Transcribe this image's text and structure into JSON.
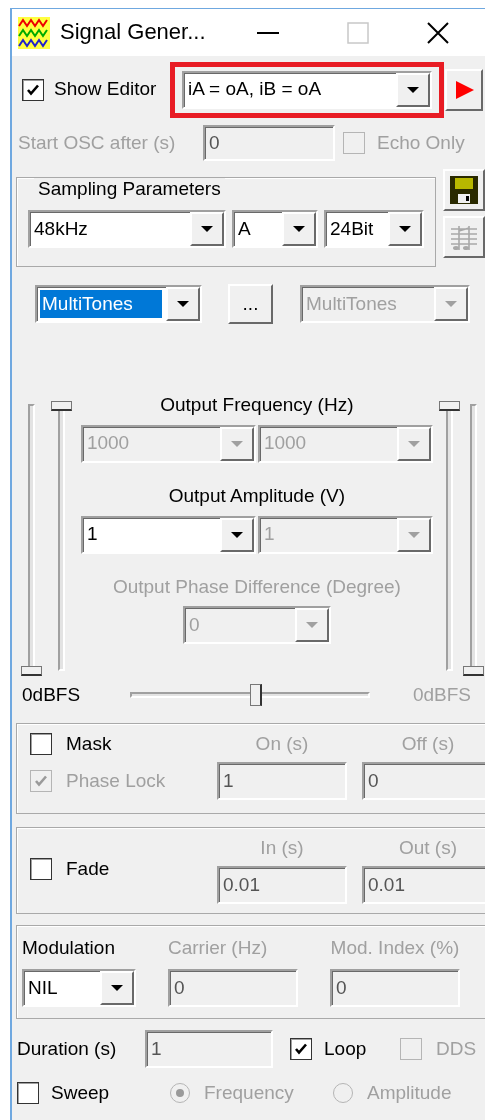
{
  "window": {
    "title": "Signal Gener..."
  },
  "editor": {
    "show": {
      "label": "Show Editor",
      "checked": true
    },
    "mode": {
      "value": "iA = oA, iB = oA",
      "highlighted": true
    }
  },
  "start_osc": {
    "label": "Start OSC after (s)",
    "value": "0",
    "disabled": true
  },
  "echo_only": {
    "label": "Echo Only",
    "checked": false,
    "disabled": true
  },
  "sampling": {
    "title": "Sampling Parameters",
    "rate": {
      "value": "48kHz"
    },
    "channel": {
      "value": "A"
    },
    "bits": {
      "value": "24Bit"
    }
  },
  "side_tools": [
    {
      "kind": "save",
      "disabled": false
    },
    {
      "kind": "staff",
      "disabled": true
    }
  ],
  "tone": {
    "type": {
      "value": "MultiTones",
      "selected": true
    },
    "more": "...",
    "type_b": {
      "value": "MultiTones",
      "disabled": true
    }
  },
  "output": {
    "frequency": {
      "label": "Output Frequency (Hz)",
      "disabled": false,
      "fields": [
        {
          "value": "1000",
          "disabled": true
        },
        {
          "value": "1000",
          "disabled": true
        }
      ]
    },
    "amplitude": {
      "label": "Output Amplitude (V)",
      "disabled": false,
      "fields": [
        {
          "value": "1",
          "disabled": false
        },
        {
          "value": "1",
          "disabled": true
        }
      ]
    },
    "phase": {
      "label": "Output Phase Difference (Degree)",
      "disabled": true,
      "fields": [
        {
          "value": "0",
          "disabled": true
        }
      ]
    }
  },
  "levels": {
    "left": [
      {
        "level": 0
      },
      {
        "level": 1
      }
    ],
    "right": [
      {
        "level": 1
      },
      {
        "level": 0
      }
    ],
    "balance": {
      "level": 0.53
    },
    "left_label": {
      "text": "0dBFS",
      "disabled": false
    },
    "right_label": {
      "text": "0dBFS",
      "disabled": true
    }
  },
  "mask": {
    "check": {
      "label": "Mask",
      "checked": false
    },
    "phase_lock": {
      "label": "Phase Lock",
      "checked": true,
      "disabled": true
    },
    "fields": [
      {
        "label": "On (s)",
        "value": "1",
        "disabled": true
      },
      {
        "label": "Off (s)",
        "value": "0",
        "disabled": true
      }
    ]
  },
  "fade": {
    "check": {
      "label": "Fade",
      "checked": false
    },
    "fields": [
      {
        "label": "In (s)",
        "value": "0.01",
        "disabled": true
      },
      {
        "label": "Out (s)",
        "value": "0.01",
        "disabled": true
      }
    ]
  },
  "modulation": {
    "label": "Modulation",
    "type": {
      "value": "NIL"
    },
    "fields": [
      {
        "label": "Carrier (Hz)",
        "value": "0",
        "disabled": true
      },
      {
        "label": "Mod. Index (%)",
        "value": "0",
        "disabled": true
      }
    ]
  },
  "duration": {
    "label": "Duration (s)",
    "value": "1",
    "disabled": true
  },
  "loop": {
    "label": "Loop",
    "checked": true,
    "disabled": false
  },
  "dds": {
    "label": "DDS",
    "checked": false,
    "disabled": true
  },
  "sweep": {
    "check": {
      "label": "Sweep",
      "checked": false
    },
    "modes": [
      {
        "label": "Frequency",
        "selected": true,
        "disabled": true
      },
      {
        "label": "Amplitude",
        "selected": false,
        "disabled": true
      }
    ]
  }
}
